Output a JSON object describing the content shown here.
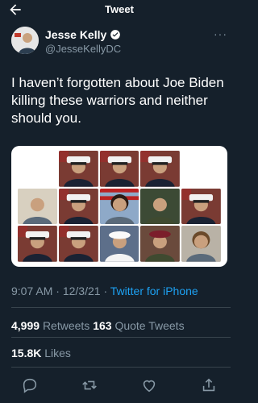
{
  "header": {
    "title": "Tweet",
    "back_icon": "arrow-left-icon"
  },
  "author": {
    "name": "Jesse Kelly",
    "handle": "@JesseKellyDC",
    "verified_icon": "verified-badge-icon"
  },
  "tweet": {
    "text": "I haven’t forgotten about Joe Biden killing these warriors and neither should you.",
    "time": "9:07 AM",
    "date": "12/3/21",
    "source": "Twitter for iPhone"
  },
  "stats": {
    "retweets": "4,999",
    "retweets_label": "Retweets",
    "quotes": "163",
    "quotes_label": "Quote Tweets",
    "likes": "15.8K",
    "likes_label": "Likes"
  },
  "actions": [
    "reply-icon",
    "retweet-icon",
    "like-icon",
    "share-icon"
  ],
  "colors": {
    "background": "#15202b",
    "link": "#1da1f2",
    "secondary_text": "#8899a6"
  }
}
